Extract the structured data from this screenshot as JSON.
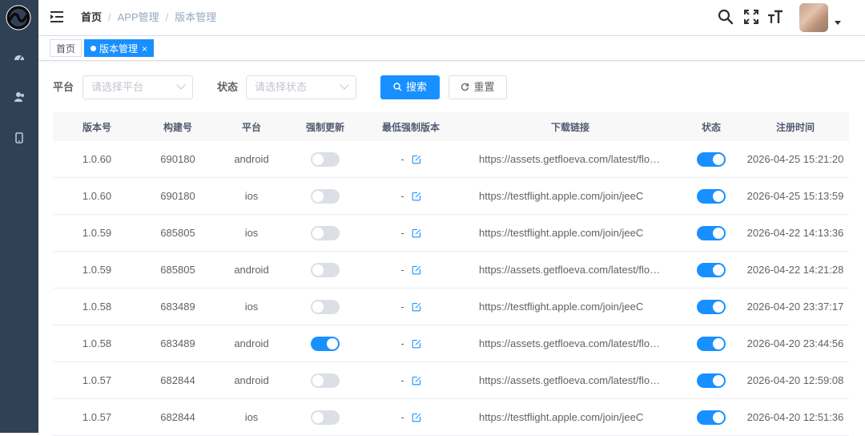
{
  "sidebar": {
    "items": [
      {
        "icon": "dashboard-icon"
      },
      {
        "icon": "users-icon"
      },
      {
        "icon": "mobile-icon"
      }
    ]
  },
  "breadcrumb": [
    "首页",
    "APP管理",
    "版本管理"
  ],
  "tags": {
    "home": "首页",
    "current": "版本管理",
    "close": "×"
  },
  "search_form": {
    "platform_label": "平台",
    "platform_placeholder": "请选择平台",
    "status_label": "状态",
    "status_placeholder": "请选择状态",
    "search_button": "搜索",
    "reset_button": "重置"
  },
  "table": {
    "headers": [
      "版本号",
      "构建号",
      "平台",
      "强制更新",
      "最低强制版本",
      "下载链接",
      "状态",
      "注册时间"
    ],
    "rows": [
      {
        "version": "1.0.60",
        "build": "690180",
        "platform": "android",
        "force": false,
        "min_version": "-",
        "url": "https://assets.getfloeva.com/latest/floeva.apk",
        "status": true,
        "time": "2026-04-25 15:21:20"
      },
      {
        "version": "1.0.60",
        "build": "690180",
        "platform": "ios",
        "force": false,
        "min_version": "-",
        "url": "https://testflight.apple.com/join/jeeC",
        "status": true,
        "time": "2026-04-25 15:13:59"
      },
      {
        "version": "1.0.59",
        "build": "685805",
        "platform": "ios",
        "force": false,
        "min_version": "-",
        "url": "https://testflight.apple.com/join/jeeC",
        "status": true,
        "time": "2026-04-22 14:13:36"
      },
      {
        "version": "1.0.59",
        "build": "685805",
        "platform": "android",
        "force": false,
        "min_version": "-",
        "url": "https://assets.getfloeva.com/latest/floeva.apk",
        "status": true,
        "time": "2026-04-22 14:21:28"
      },
      {
        "version": "1.0.58",
        "build": "683489",
        "platform": "ios",
        "force": false,
        "min_version": "-",
        "url": "https://testflight.apple.com/join/jeeC",
        "status": true,
        "time": "2026-04-20 23:37:17"
      },
      {
        "version": "1.0.58",
        "build": "683489",
        "platform": "android",
        "force": true,
        "min_version": "-",
        "url": "https://assets.getfloeva.com/latest/floeva.apk",
        "status": true,
        "time": "2026-04-20 23:44:56"
      },
      {
        "version": "1.0.57",
        "build": "682844",
        "platform": "android",
        "force": false,
        "min_version": "-",
        "url": "https://assets.getfloeva.com/latest/floeva.apk",
        "status": true,
        "time": "2026-04-20 12:59:08"
      },
      {
        "version": "1.0.57",
        "build": "682844",
        "platform": "ios",
        "force": false,
        "min_version": "-",
        "url": "https://testflight.apple.com/join/jeeC",
        "status": true,
        "time": "2026-04-20 12:51:36"
      }
    ]
  },
  "colors": {
    "sidebar_bg": "#304156",
    "primary": "#1890ff",
    "switch_off": "#dcdfe6"
  }
}
